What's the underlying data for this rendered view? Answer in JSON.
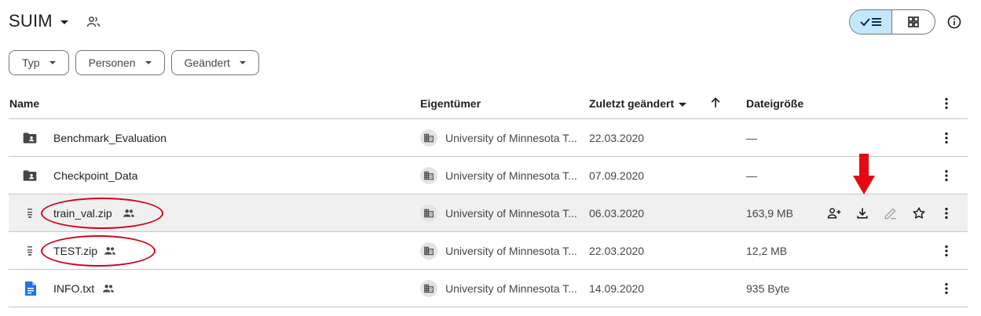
{
  "header": {
    "title": "SUIM",
    "icons": {
      "title_caret": "caret-down-icon",
      "shared": "people-outline-icon",
      "list_view": "check-list-icon",
      "grid_view": "grid-icon",
      "info": "info-icon"
    }
  },
  "filters": [
    {
      "label": "Typ"
    },
    {
      "label": "Personen"
    },
    {
      "label": "Geändert"
    }
  ],
  "columns": {
    "name": "Name",
    "owner": "Eigentümer",
    "modified": "Zuletzt geändert",
    "size": "Dateigröße"
  },
  "rows": [
    {
      "name": "Benchmark_Evaluation",
      "icon": "shared-folder-icon",
      "shared": false,
      "owner": "University of Minnesota T...",
      "modified": "22.03.2020",
      "size": "—"
    },
    {
      "name": "Checkpoint_Data",
      "icon": "shared-folder-icon",
      "shared": false,
      "owner": "University of Minnesota T...",
      "modified": "07.09.2020",
      "size": "—"
    },
    {
      "name": "train_val.zip",
      "icon": "zip-file-icon",
      "shared": true,
      "owner": "University of Minnesota T...",
      "modified": "06.03.2020",
      "size": "163,9 MB",
      "highlighted": true
    },
    {
      "name": "TEST.zip",
      "icon": "zip-file-icon",
      "shared": true,
      "owner": "University of Minnesota T...",
      "modified": "22.03.2020",
      "size": "12,2 MB"
    },
    {
      "name": "INFO.txt",
      "icon": "document-icon",
      "shared": true,
      "owner": "University of Minnesota T...",
      "modified": "14.09.2020",
      "size": "935 Byte"
    }
  ],
  "row_actions": [
    "share-icon",
    "download-icon",
    "rename-icon",
    "star-icon"
  ],
  "annotation_color": "#d0021b",
  "accent_color": "#c2e7ff",
  "doc_icon_color": "#1a73e8"
}
